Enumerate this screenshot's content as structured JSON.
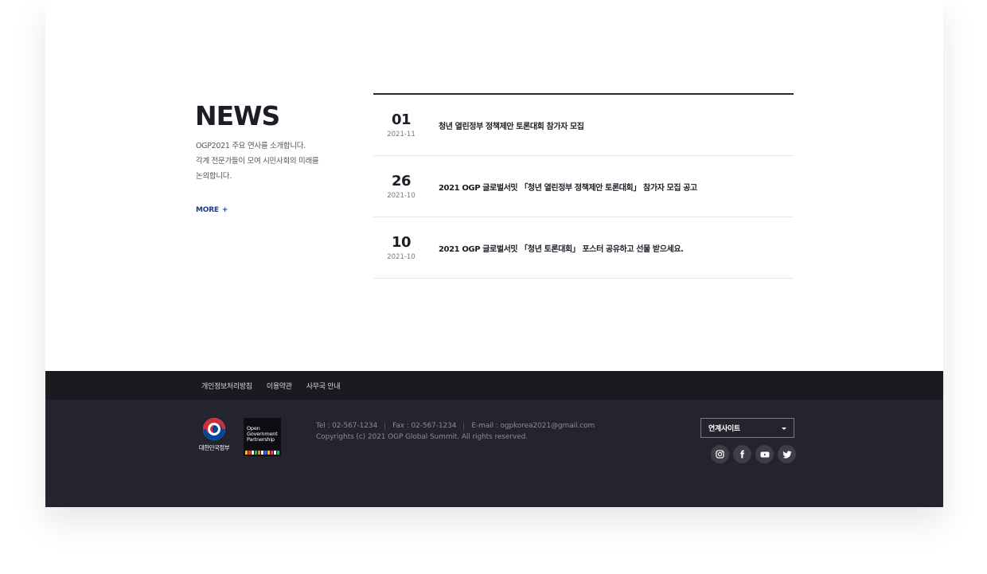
{
  "news": {
    "title": "NEWS",
    "description": [
      "OGP2021 주요 연사를 소개합니다.",
      "각계 전문가들이 모여 시민사회의 미래를",
      "논의합니다."
    ],
    "more_label": "MORE",
    "more_icon": "plus-icon",
    "items": [
      {
        "day": "01",
        "year_month": "2021-11",
        "title": "청년 열린정부 정책제안 토론대회 참가자 모집"
      },
      {
        "day": "26",
        "year_month": "2021-10",
        "title": "2021 OGP 글로벌서밋 「청년 열린정부 정책제안 토론대회」 참가자 모집 공고"
      },
      {
        "day": "10",
        "year_month": "2021-10",
        "title": "2021 OGP 글로벌서밋 「청년 토론대회」 포스터 공유하고 선물 받으세요."
      }
    ]
  },
  "footer": {
    "links": [
      "개인정보처리방침",
      "이용약관",
      "사무국 안내"
    ],
    "gov_logo_text": "대한민국정부",
    "ogp_logo_text": [
      "Open",
      "Government",
      "Partnership"
    ],
    "tel": "Tel : 02-567-1234",
    "fax": "Fax : 02-567-1234",
    "email": "E-mail : ogpkorea2021@gmail.com",
    "copyright": "Copyrights (c) 2021 OGP Global Summit. All rights reserved.",
    "related_site_label": "연계사이트",
    "social_icons": [
      "instagram-icon",
      "facebook-icon",
      "youtube-icon",
      "twitter-icon"
    ]
  },
  "colors": {
    "footer_top_bg": "#1a1b20",
    "footer_bg": "#23242d",
    "more_link": "#1d3a8c",
    "text_dark": "#1c1d27"
  }
}
